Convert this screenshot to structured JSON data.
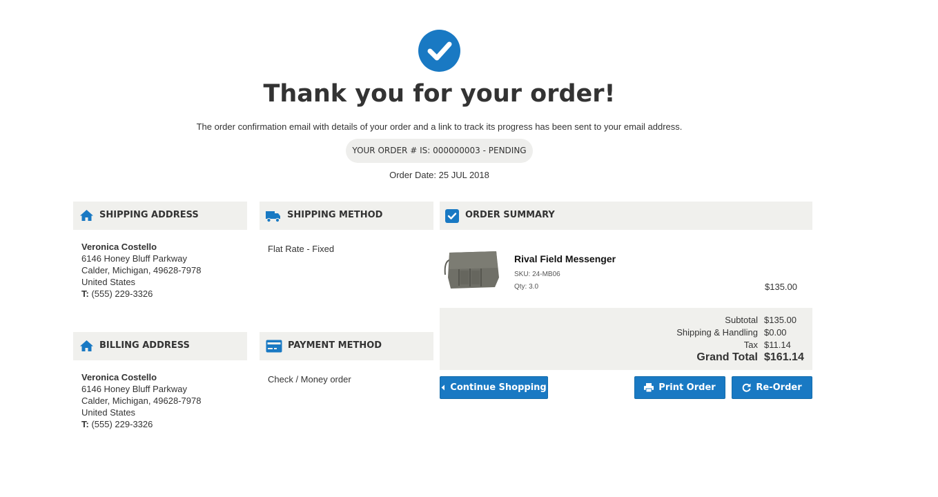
{
  "header": {
    "title": "Thank you for your order!",
    "message": "The order confirmation email with details of your order and a link to track its progress has been sent to your email address.",
    "order_number": "YOUR ORDER # IS: 000000003 - PENDING",
    "order_date": "Order Date: 25 JUL 2018"
  },
  "shipping_address": {
    "heading": "SHIPPING ADDRESS",
    "name": "Veronica Costello",
    "street": "6146 Honey Bluff Parkway",
    "city": "Calder, Michigan, 49628-7978",
    "country": "United States",
    "tel_label": "T:",
    "tel": "(555) 229-3326"
  },
  "billing_address": {
    "heading": "BILLING ADDRESS",
    "name": "Veronica Costello",
    "street": "6146 Honey Bluff Parkway",
    "city": "Calder, Michigan, 49628-7978",
    "country": "United States",
    "tel_label": "T:",
    "tel": "(555) 229-3326"
  },
  "shipping_method": {
    "heading": "SHIPPING METHOD",
    "value": "Flat Rate - Fixed"
  },
  "payment_method": {
    "heading": "PAYMENT METHOD",
    "value": "Check / Money order"
  },
  "order_summary": {
    "heading": "ORDER SUMMARY",
    "item": {
      "name": "Rival Field Messenger",
      "sku": "SKU: 24-MB06",
      "qty": "Qty: 3.0",
      "price": "$135.00"
    },
    "totals": {
      "subtotal_label": "Subtotal",
      "subtotal": "$135.00",
      "shipping_label": "Shipping & Handling",
      "shipping": "$0.00",
      "tax_label": "Tax",
      "tax": "$11.14",
      "grand_label": "Grand Total",
      "grand": "$161.14"
    }
  },
  "buttons": {
    "continue": "Continue Shopping",
    "print": "Print Order",
    "reorder": "Re-Order"
  },
  "icons": {
    "success": "check-circle-icon",
    "shipping_address": "home-icon",
    "billing_address": "home-icon",
    "shipping_method": "truck-icon",
    "payment_method": "credit-card-icon",
    "order_summary": "checkbox-icon",
    "continue": "caret-left-icon",
    "print": "printer-icon",
    "reorder": "refresh-icon"
  },
  "colors": {
    "accent": "#1979c3",
    "panel": "#f0f0ed",
    "text": "#333333"
  }
}
